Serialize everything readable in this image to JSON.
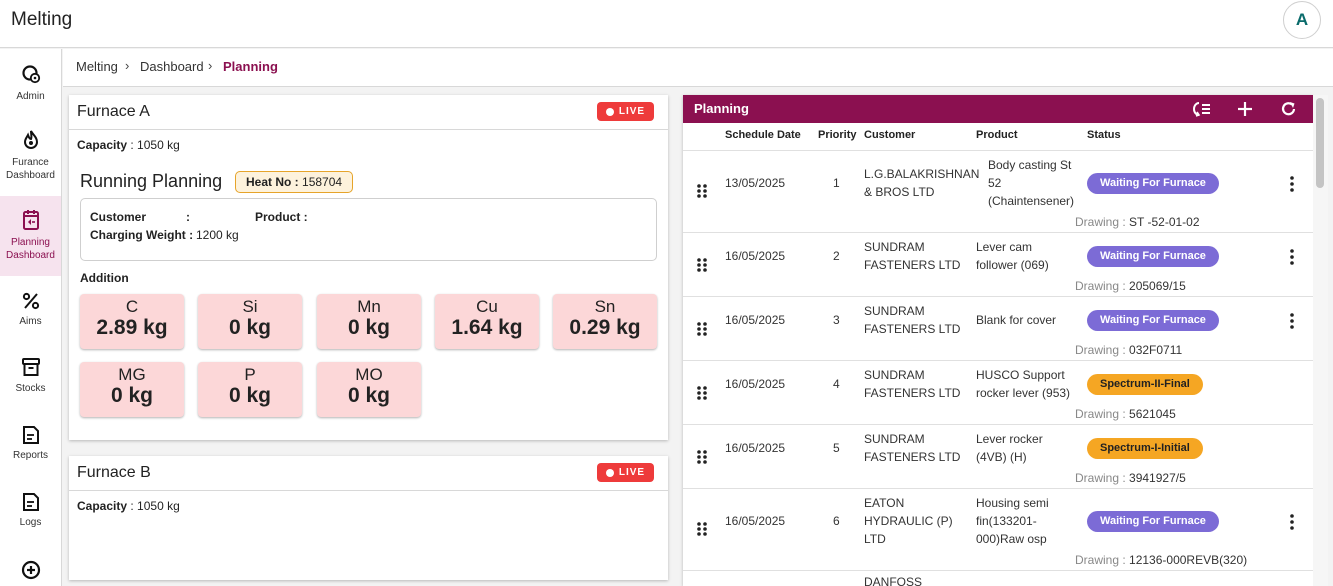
{
  "app": {
    "title": "Melting",
    "avatar_letter": "A"
  },
  "sidebar": {
    "items": [
      {
        "label": "Admin",
        "icon": "admin-gear-icon"
      },
      {
        "label": "Furance Dashboard",
        "icon": "flame-icon"
      },
      {
        "label": "Planning Dashboard",
        "icon": "calendar-icon",
        "active": true
      },
      {
        "label": "Aims",
        "icon": "percent-icon"
      },
      {
        "label": "Stocks",
        "icon": "archive-box-icon"
      },
      {
        "label": "Reports",
        "icon": "document-icon"
      },
      {
        "label": "Logs",
        "icon": "document-icon"
      },
      {
        "label": "",
        "icon": "circle-plus-icon"
      }
    ]
  },
  "breadcrumb": {
    "items": [
      "Melting",
      "Dashboard",
      "Planning"
    ]
  },
  "furnace_a": {
    "title": "Furnace A",
    "live": "LIVE",
    "capacity_label": "Capacity",
    "capacity_value": "1050 kg",
    "running_title": "Running Planning",
    "heat_label": "Heat No :",
    "heat_value": "158704",
    "customer_label": "Customer",
    "product_label": "Product :",
    "charging_label": "Charging Weight :",
    "charging_value": "1200 kg",
    "addition_label": "Addition",
    "additions": [
      {
        "element": "C",
        "value": "2.89 kg"
      },
      {
        "element": "Si",
        "value": "0 kg"
      },
      {
        "element": "Mn",
        "value": "0 kg"
      },
      {
        "element": "Cu",
        "value": "1.64 kg"
      },
      {
        "element": "Sn",
        "value": "0.29 kg"
      },
      {
        "element": "MG",
        "value": "0 kg"
      },
      {
        "element": "P",
        "value": "0 kg"
      },
      {
        "element": "MO",
        "value": "0 kg"
      }
    ]
  },
  "furnace_b": {
    "title": "Furnace B",
    "live": "LIVE",
    "capacity_label": "Capacity",
    "capacity_value": "1050 kg"
  },
  "planning": {
    "title": "Planning",
    "columns": [
      "Schedule Date",
      "Priority",
      "Customer",
      "Product",
      "Status"
    ],
    "drawing_label": "Drawing :",
    "rows": [
      {
        "date": "13/05/2025",
        "priority": "1",
        "customer": [
          "L.G.BALAKRISHNAN",
          "& BROS LTD"
        ],
        "product": [
          "Body casting St",
          "52",
          "(Chaintensener)"
        ],
        "status": "Waiting For Furnace",
        "drawing": "ST -52-01-02"
      },
      {
        "date": "16/05/2025",
        "priority": "2",
        "customer": [
          "SUNDRAM",
          "FASTENERS LTD"
        ],
        "product": [
          "Lever cam",
          "follower (069)"
        ],
        "status": "Waiting For Furnace",
        "drawing": "205069/15"
      },
      {
        "date": "16/05/2025",
        "priority": "3",
        "customer": [
          "SUNDRAM",
          "FASTENERS LTD"
        ],
        "product": [
          "Blank for cover"
        ],
        "status": "Waiting For Furnace",
        "drawing": "032F0711"
      },
      {
        "date": "16/05/2025",
        "priority": "4",
        "customer": [
          "SUNDRAM",
          "FASTENERS LTD"
        ],
        "product": [
          "HUSCO Support",
          "rocker lever (953)"
        ],
        "status": "Spectrum-II-Final",
        "drawing": "5621045"
      },
      {
        "date": "16/05/2025",
        "priority": "5",
        "customer": [
          "SUNDRAM",
          "FASTENERS LTD"
        ],
        "product": [
          "Lever rocker",
          "(4VB) (H)"
        ],
        "status": "Spectrum-I-Initial",
        "drawing": "3941927/5"
      },
      {
        "date": "16/05/2025",
        "priority": "6",
        "customer": [
          "EATON",
          "HYDRAULIC (P)",
          "LTD"
        ],
        "product": [
          "Housing semi",
          "fin(133201-",
          "000)Raw osp"
        ],
        "status": "Waiting For Furnace",
        "drawing": "12136-000REVB(320)"
      }
    ],
    "partial_row_customer": "DANFOSS"
  },
  "colors": {
    "brand": "#8b1050",
    "waiting": "#7c6bd6",
    "spectrum": "#f5a623",
    "live": "#ee3b3b",
    "tile": "#fcd7d8"
  }
}
